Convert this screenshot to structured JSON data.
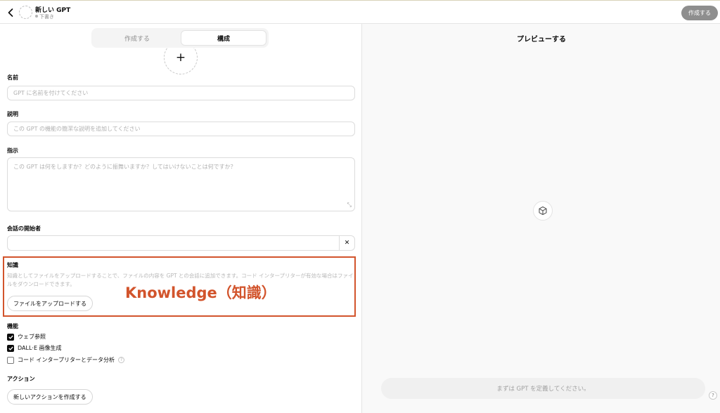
{
  "header": {
    "gpt_name": "新しい GPT",
    "status": "下書き",
    "create_label": "作成する"
  },
  "tabs": [
    {
      "label": "作成する",
      "active": false
    },
    {
      "label": "構成",
      "active": true
    }
  ],
  "avatar": {
    "plus": "+"
  },
  "form": {
    "name_label": "名前",
    "name_placeholder": "GPT に名前を付けてください",
    "desc_label": "説明",
    "desc_placeholder": "この GPT の機能の簡潔な説明を追加してください",
    "instr_label": "指示",
    "instr_placeholder": "この GPT は何をしますか？どのように振舞いますか？してはいけないことは何ですか？",
    "starter_label": "会話の開始者",
    "starter_value": "",
    "starter_clear": "✕"
  },
  "knowledge": {
    "label": "知識",
    "description": "知識としてファイルをアップロードすることで、ファイルの内容を GPT との会話に追加できます。コード インタープリターが有効な場合はファイルをダウンロードできます。",
    "annotation": "Knowledge（知識）",
    "upload_label": "ファイルをアップロードする",
    "highlight_color": "#d2542c"
  },
  "capabilities": {
    "label": "機能",
    "items": [
      {
        "label": "ウェブ参照",
        "checked": true
      },
      {
        "label": "DALL·E 画像生成",
        "checked": true
      },
      {
        "label": "コード インタープリターとデータ分析",
        "checked": false
      }
    ],
    "help": "?"
  },
  "actions": {
    "label": "アクション",
    "create_label": "新しいアクションを作成する"
  },
  "preview": {
    "title": "プレビューする",
    "input_placeholder": "まずは GPT を定義してください。",
    "help": "?"
  }
}
